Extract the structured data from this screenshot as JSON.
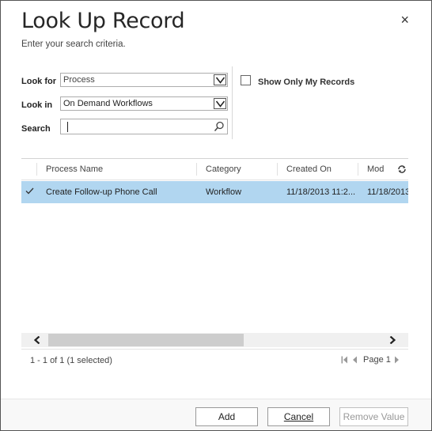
{
  "dialog": {
    "title": "Look Up Record",
    "subtitle": "Enter your search criteria.",
    "close_glyph": "×"
  },
  "criteria": {
    "look_for_label": "Look for",
    "look_for_value": "Process",
    "look_in_label": "Look in",
    "look_in_value": "On Demand Workflows",
    "search_label": "Search",
    "search_value": "",
    "show_only_mine_label": "Show Only My Records",
    "show_only_mine_checked": false
  },
  "grid": {
    "columns": [
      "Process Name",
      "Category",
      "Created On",
      "Mod"
    ],
    "rows": [
      {
        "selected": true,
        "process_name": "Create Follow-up Phone Call",
        "category": "Workflow",
        "created_on": "11/18/2013 11:2...",
        "modified_on": "11/18/2013"
      }
    ],
    "refresh_icon": "refresh-icon"
  },
  "status": {
    "count_text": "1 - 1 of 1 (1 selected)",
    "page_text": "Page 1"
  },
  "buttons": {
    "add": "Add",
    "cancel": "Cancel",
    "remove_value": "Remove Value"
  },
  "colors": {
    "selected_row": "#b1d6f0",
    "scroll_thumb": "#cdcdcd"
  }
}
